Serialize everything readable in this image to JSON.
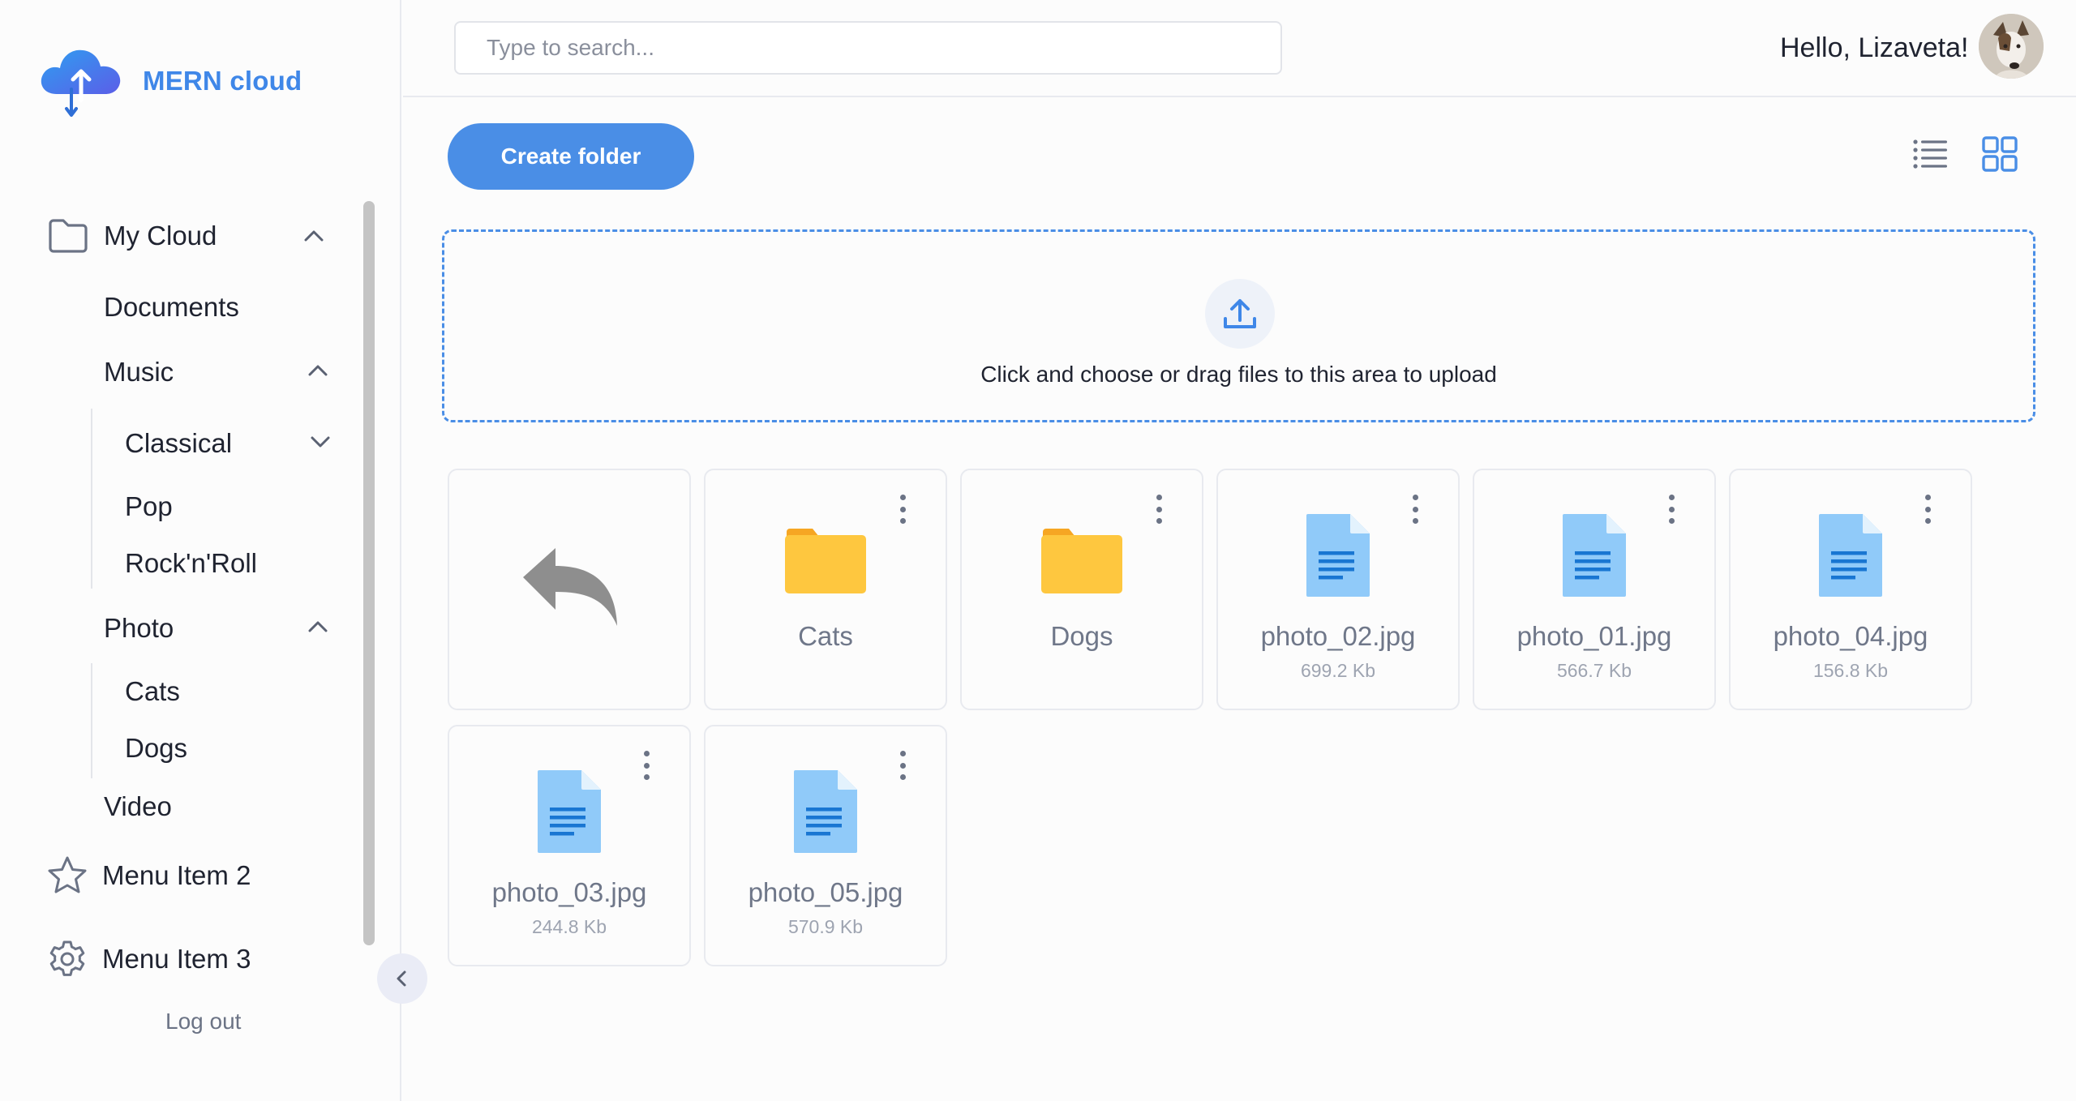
{
  "app": {
    "name": "MERN cloud"
  },
  "header": {
    "search_placeholder": "Type to search...",
    "greeting": "Hello, Lizaveta!"
  },
  "sidebar": {
    "my_cloud": "My Cloud",
    "documents": "Documents",
    "music": "Music",
    "classical": "Classical",
    "pop": "Pop",
    "rocknroll": "Rock'n'Roll",
    "photo": "Photo",
    "cats": "Cats",
    "dogs": "Dogs",
    "video": "Video",
    "menu_item_2": "Menu Item 2",
    "menu_item_3": "Menu Item 3",
    "logout": "Log out"
  },
  "toolbar": {
    "create_folder": "Create folder",
    "view_mode": "grid"
  },
  "dropzone": {
    "text": "Click and choose or drag files to this area to upload"
  },
  "files": [
    {
      "name": "Cats",
      "type": "folder"
    },
    {
      "name": "Dogs",
      "type": "folder"
    },
    {
      "name": "photo_02.jpg",
      "type": "file",
      "size": "699.2 Kb"
    },
    {
      "name": "photo_01.jpg",
      "type": "file",
      "size": "566.7 Kb"
    },
    {
      "name": "photo_04.jpg",
      "type": "file",
      "size": "156.8 Kb"
    },
    {
      "name": "photo_03.jpg",
      "type": "file",
      "size": "244.8 Kb"
    },
    {
      "name": "photo_05.jpg",
      "type": "file",
      "size": "570.9 Kb"
    }
  ],
  "colors": {
    "accent": "#4a8ee6",
    "folder": "#fec73f",
    "file": "#90caf9"
  }
}
